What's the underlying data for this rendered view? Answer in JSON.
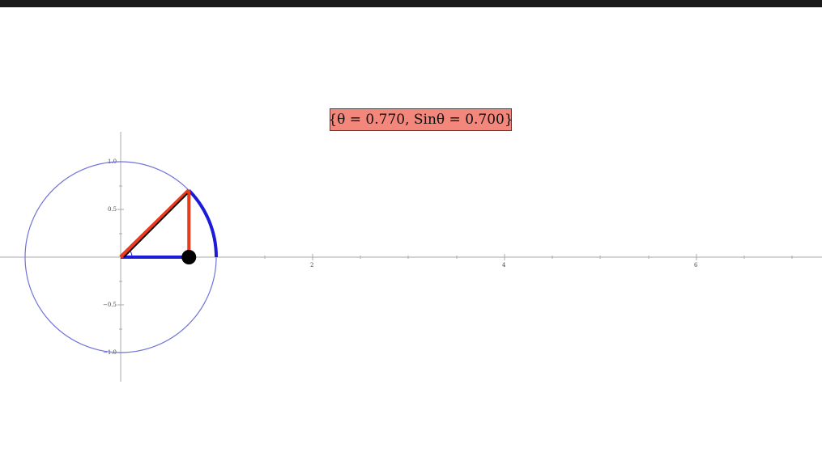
{
  "label": {
    "text": "{θ = 0.770, Sinθ = 0.700}"
  },
  "diagram": {
    "theta": 0.77,
    "sin_theta": 0.7,
    "colors": {
      "circle": "#6f73d8",
      "arc": "#1b1bd8",
      "adjacent": "#1b1bd8",
      "hypotenuse_outer": "#e83a1c",
      "hypotenuse_inner": "#000000",
      "opposite": "#e83a1c",
      "point": "#000000",
      "label_bg": "#f4877b"
    }
  },
  "axes": {
    "x_ticks": [
      "2",
      "4",
      "6"
    ],
    "y_ticks": [
      "1.0",
      "0.5",
      "−0.5",
      "−1.0"
    ]
  }
}
